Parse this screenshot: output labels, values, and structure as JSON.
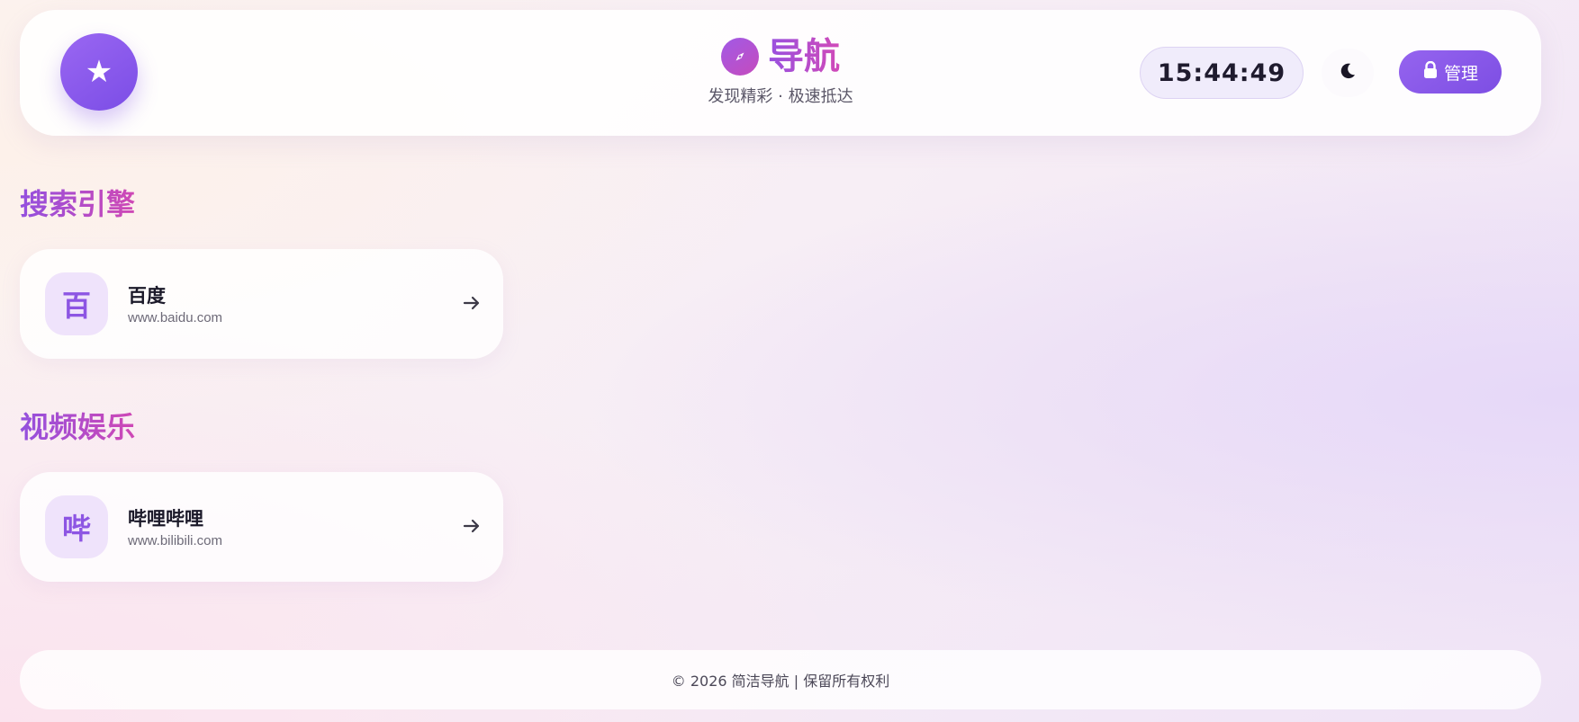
{
  "header": {
    "logo_glyph": "★",
    "title": "导航",
    "subtitle": "发现精彩 · 极速抵达",
    "clock": "15:44:49",
    "theme_icon": "moon-icon",
    "admin_label": "管理",
    "admin_icon": "lock-icon",
    "title_icon": "compass-icon"
  },
  "sections": [
    {
      "title": "搜索引擎",
      "cards": [
        {
          "icon_char": "百",
          "name": "百度",
          "url": "www.baidu.com",
          "arrow_icon": "arrow-right-icon"
        }
      ]
    },
    {
      "title": "视频娱乐",
      "cards": [
        {
          "icon_char": "哔",
          "name": "哔哩哔哩",
          "url": "www.bilibili.com",
          "arrow_icon": "arrow-right-icon"
        }
      ]
    }
  ],
  "footer": {
    "text": "© 2026 简洁导航 | 保留所有权利"
  },
  "colors": {
    "accent_purple": "#8b5cf6",
    "title_gradient_start": "#9350de",
    "title_gradient_end": "#cf48b5",
    "clock_bg": "#f0ecfb",
    "icon_tile_bg": "#efe3fb"
  }
}
